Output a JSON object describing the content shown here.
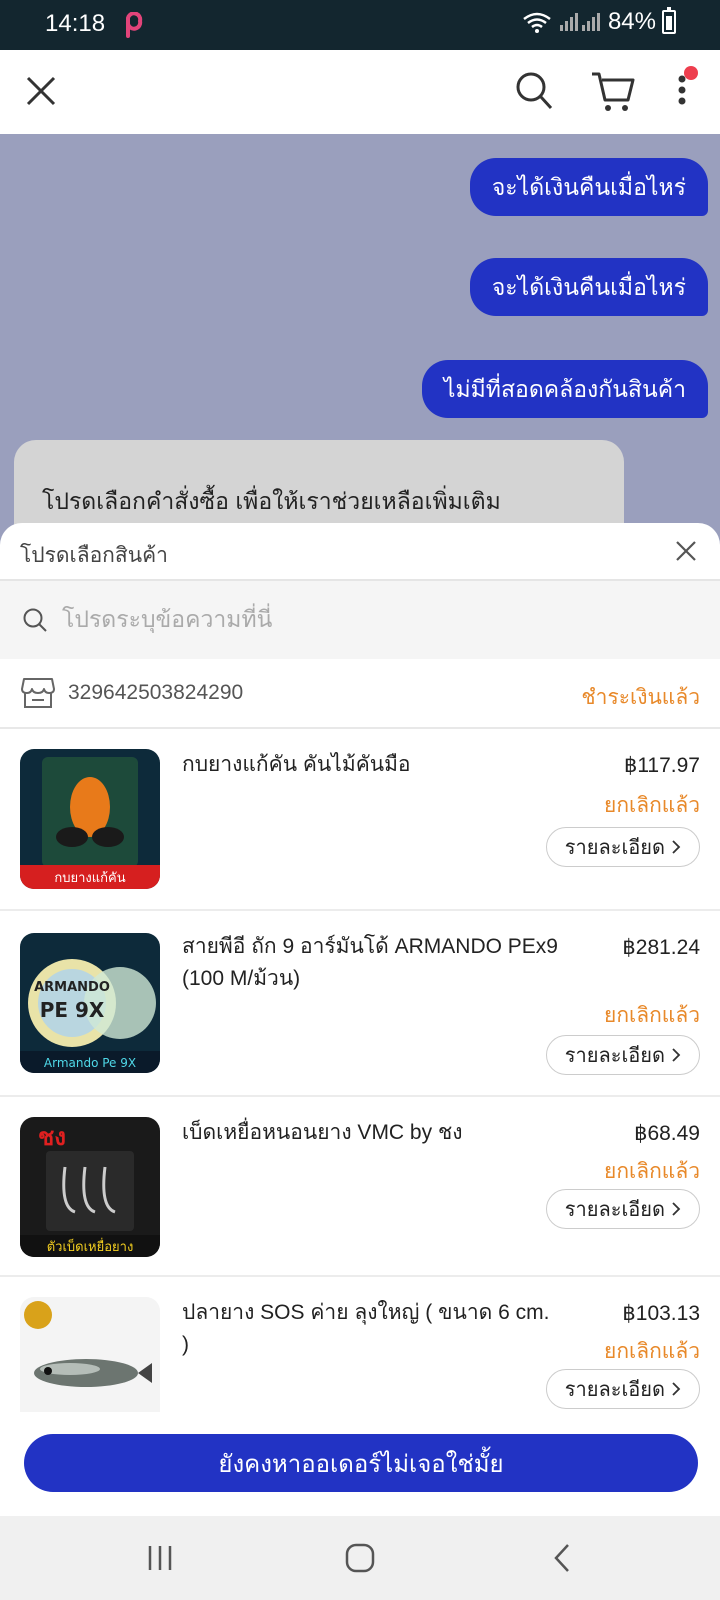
{
  "status_bar": {
    "time": "14:18",
    "battery": "84%"
  },
  "chat": {
    "messages": [
      "จะได้เงินคืนเมื่อไหร่",
      "จะได้เงินคืนเมื่อไหร่",
      "ไม่มีที่สอดคล้องกันสินค้า"
    ],
    "bot_text": "โปรดเลือกคำสั่งซื้อ เพื่อให้เราช่วยเหลือเพิ่มเติม"
  },
  "sheet": {
    "title": "โปรดเลือกสินค้า",
    "search_placeholder": "โปรดระบุข้อความที่นี่",
    "order_id": "329642503824290",
    "order_status": "ชำระเงินแล้ว",
    "detail_label": "รายละเอียด",
    "products": [
      {
        "name": "กบยางแก้คัน คันไม้คันมือ",
        "price": "฿117.97",
        "status": "ยกเลิกแล้ว"
      },
      {
        "name": "สายพีอี ถัก 9 อาร์มันโด้ ARMANDO PEx9 (100 M/ม้วน)",
        "price": "฿281.24",
        "status": "ยกเลิกแล้ว"
      },
      {
        "name": "เบ็ดเหยื่อหนอนยาง VMC by ชง",
        "price": "฿68.49",
        "status": "ยกเลิกแล้ว"
      },
      {
        "name": "ปลายาง SOS ค่าย ลุงใหญ่ ( ขนาด 6 cm. )",
        "price": "฿103.13",
        "status": "ยกเลิกแล้ว"
      }
    ],
    "cta_label": "ยังคงหาออเดอร์ไม่เจอใช่มั้ย"
  },
  "colors": {
    "accent": "#2233c4",
    "status_orange": "#e8892a",
    "chat_bg": "#9a9fbd"
  }
}
